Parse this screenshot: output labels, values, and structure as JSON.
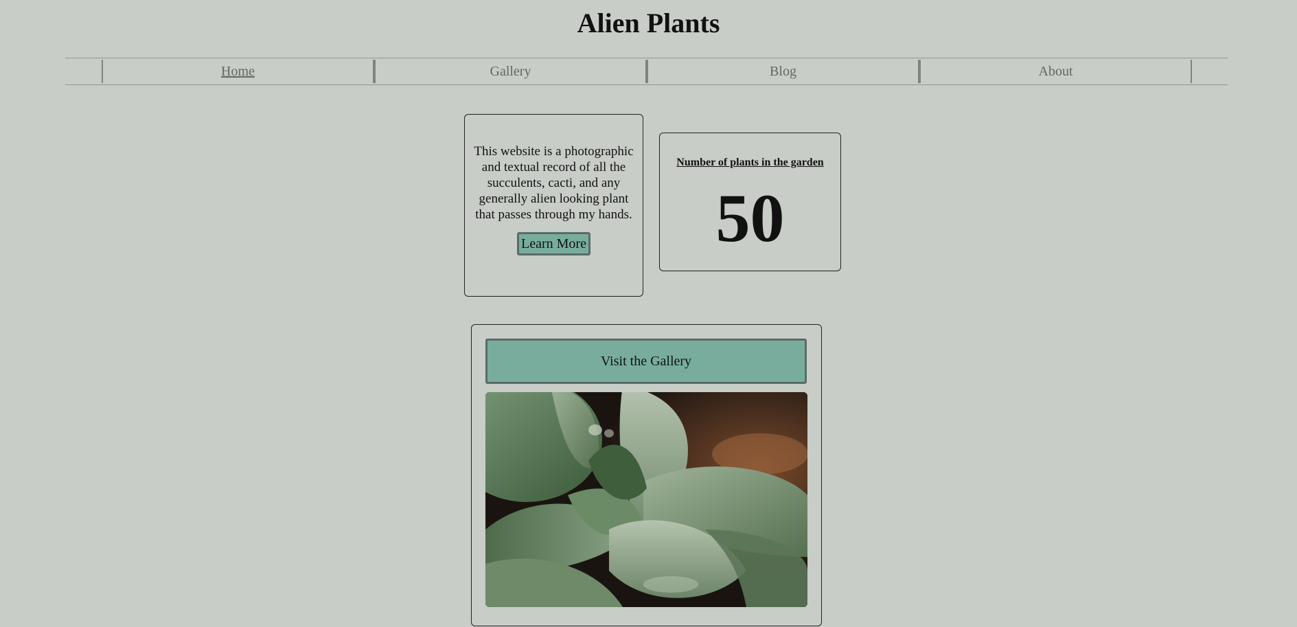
{
  "site": {
    "title": "Alien Plants"
  },
  "nav": {
    "items": [
      {
        "label": "Home",
        "active": true
      },
      {
        "label": "Gallery",
        "active": false
      },
      {
        "label": "Blog",
        "active": false
      },
      {
        "label": "About",
        "active": false
      }
    ]
  },
  "intro": {
    "text": "This website is a photographic and textual record of all the succulents, cacti, and any generally alien looking plant that passes through my hands.",
    "button_label": "Learn More"
  },
  "counter": {
    "label": "Number of plants in the garden",
    "value": "50"
  },
  "gallery": {
    "button_label": "Visit the Gallery",
    "photo_subject": "succulent-rosette"
  },
  "colors": {
    "background": "#c8cdc7",
    "accent": "#78ad9e",
    "border": "#5b6b66"
  }
}
